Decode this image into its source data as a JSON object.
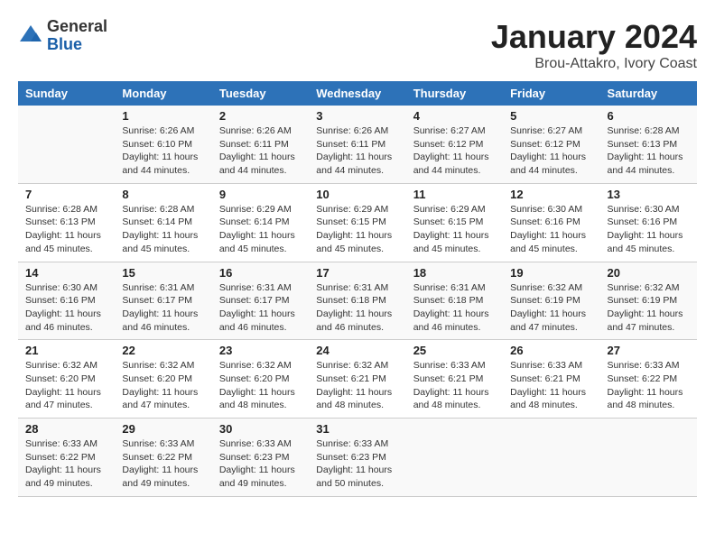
{
  "header": {
    "logo_general": "General",
    "logo_blue": "Blue",
    "month_title": "January 2024",
    "location": "Brou-Attakro, Ivory Coast"
  },
  "days_of_week": [
    "Sunday",
    "Monday",
    "Tuesday",
    "Wednesday",
    "Thursday",
    "Friday",
    "Saturday"
  ],
  "weeks": [
    [
      {
        "day": "",
        "info": ""
      },
      {
        "day": "1",
        "info": "Sunrise: 6:26 AM\nSunset: 6:10 PM\nDaylight: 11 hours\nand 44 minutes."
      },
      {
        "day": "2",
        "info": "Sunrise: 6:26 AM\nSunset: 6:11 PM\nDaylight: 11 hours\nand 44 minutes."
      },
      {
        "day": "3",
        "info": "Sunrise: 6:26 AM\nSunset: 6:11 PM\nDaylight: 11 hours\nand 44 minutes."
      },
      {
        "day": "4",
        "info": "Sunrise: 6:27 AM\nSunset: 6:12 PM\nDaylight: 11 hours\nand 44 minutes."
      },
      {
        "day": "5",
        "info": "Sunrise: 6:27 AM\nSunset: 6:12 PM\nDaylight: 11 hours\nand 44 minutes."
      },
      {
        "day": "6",
        "info": "Sunrise: 6:28 AM\nSunset: 6:13 PM\nDaylight: 11 hours\nand 44 minutes."
      }
    ],
    [
      {
        "day": "7",
        "info": "Sunrise: 6:28 AM\nSunset: 6:13 PM\nDaylight: 11 hours\nand 45 minutes."
      },
      {
        "day": "8",
        "info": "Sunrise: 6:28 AM\nSunset: 6:14 PM\nDaylight: 11 hours\nand 45 minutes."
      },
      {
        "day": "9",
        "info": "Sunrise: 6:29 AM\nSunset: 6:14 PM\nDaylight: 11 hours\nand 45 minutes."
      },
      {
        "day": "10",
        "info": "Sunrise: 6:29 AM\nSunset: 6:15 PM\nDaylight: 11 hours\nand 45 minutes."
      },
      {
        "day": "11",
        "info": "Sunrise: 6:29 AM\nSunset: 6:15 PM\nDaylight: 11 hours\nand 45 minutes."
      },
      {
        "day": "12",
        "info": "Sunrise: 6:30 AM\nSunset: 6:16 PM\nDaylight: 11 hours\nand 45 minutes."
      },
      {
        "day": "13",
        "info": "Sunrise: 6:30 AM\nSunset: 6:16 PM\nDaylight: 11 hours\nand 45 minutes."
      }
    ],
    [
      {
        "day": "14",
        "info": "Sunrise: 6:30 AM\nSunset: 6:16 PM\nDaylight: 11 hours\nand 46 minutes."
      },
      {
        "day": "15",
        "info": "Sunrise: 6:31 AM\nSunset: 6:17 PM\nDaylight: 11 hours\nand 46 minutes."
      },
      {
        "day": "16",
        "info": "Sunrise: 6:31 AM\nSunset: 6:17 PM\nDaylight: 11 hours\nand 46 minutes."
      },
      {
        "day": "17",
        "info": "Sunrise: 6:31 AM\nSunset: 6:18 PM\nDaylight: 11 hours\nand 46 minutes."
      },
      {
        "day": "18",
        "info": "Sunrise: 6:31 AM\nSunset: 6:18 PM\nDaylight: 11 hours\nand 46 minutes."
      },
      {
        "day": "19",
        "info": "Sunrise: 6:32 AM\nSunset: 6:19 PM\nDaylight: 11 hours\nand 47 minutes."
      },
      {
        "day": "20",
        "info": "Sunrise: 6:32 AM\nSunset: 6:19 PM\nDaylight: 11 hours\nand 47 minutes."
      }
    ],
    [
      {
        "day": "21",
        "info": "Sunrise: 6:32 AM\nSunset: 6:20 PM\nDaylight: 11 hours\nand 47 minutes."
      },
      {
        "day": "22",
        "info": "Sunrise: 6:32 AM\nSunset: 6:20 PM\nDaylight: 11 hours\nand 47 minutes."
      },
      {
        "day": "23",
        "info": "Sunrise: 6:32 AM\nSunset: 6:20 PM\nDaylight: 11 hours\nand 48 minutes."
      },
      {
        "day": "24",
        "info": "Sunrise: 6:32 AM\nSunset: 6:21 PM\nDaylight: 11 hours\nand 48 minutes."
      },
      {
        "day": "25",
        "info": "Sunrise: 6:33 AM\nSunset: 6:21 PM\nDaylight: 11 hours\nand 48 minutes."
      },
      {
        "day": "26",
        "info": "Sunrise: 6:33 AM\nSunset: 6:21 PM\nDaylight: 11 hours\nand 48 minutes."
      },
      {
        "day": "27",
        "info": "Sunrise: 6:33 AM\nSunset: 6:22 PM\nDaylight: 11 hours\nand 48 minutes."
      }
    ],
    [
      {
        "day": "28",
        "info": "Sunrise: 6:33 AM\nSunset: 6:22 PM\nDaylight: 11 hours\nand 49 minutes."
      },
      {
        "day": "29",
        "info": "Sunrise: 6:33 AM\nSunset: 6:22 PM\nDaylight: 11 hours\nand 49 minutes."
      },
      {
        "day": "30",
        "info": "Sunrise: 6:33 AM\nSunset: 6:23 PM\nDaylight: 11 hours\nand 49 minutes."
      },
      {
        "day": "31",
        "info": "Sunrise: 6:33 AM\nSunset: 6:23 PM\nDaylight: 11 hours\nand 50 minutes."
      },
      {
        "day": "",
        "info": ""
      },
      {
        "day": "",
        "info": ""
      },
      {
        "day": "",
        "info": ""
      }
    ]
  ]
}
